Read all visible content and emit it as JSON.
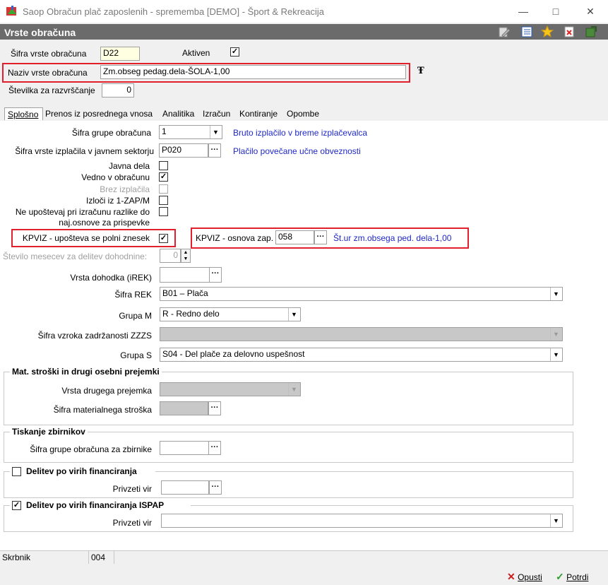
{
  "window": {
    "title": "Saop Obračun plač zaposlenih - sprememba [DEMO] - Šport & Rekreacija",
    "header": "Vrste obračuna"
  },
  "top": {
    "sifra_label": "Šifra vrste obračuna",
    "sifra_value": "D22",
    "aktiven_label": "Aktiven",
    "aktiven_checked": "✓",
    "naziv_label": "Naziv vrste obračuna",
    "naziv_value": "Zm.obseg pedag.dela-ŠOLA-1,00",
    "stevilka_label": "Številka  za razvrščanje",
    "stevilka_value": "0"
  },
  "tabs": [
    {
      "label": "Splošno"
    },
    {
      "label": "Prenos iz posrednega vnosa"
    },
    {
      "label": "Analitika"
    },
    {
      "label": "Izračun"
    },
    {
      "label": "Kontiranje"
    },
    {
      "label": "Opombe"
    }
  ],
  "general": {
    "grupa_label": "Šifra grupe obračuna",
    "grupa_value": "1",
    "grupa_desc": "Bruto izplačilo v breme izplačevalca",
    "izplacila_label": "Šifra vrste izplačila v javnem sektorju",
    "izplacila_value": "P020",
    "izplacila_desc": "Plačilo povečane učne obveznosti",
    "javna_dela_label": "Javna dela",
    "vedno_label": "Vedno v obračunu",
    "vedno_checked": "✓",
    "brez_label": "Brez izplačila",
    "izloci_label": "Izloči iz 1-ZAP/M",
    "neupostevaj_label1": "Ne upoštevaj pri izračunu razlike do",
    "neupostevaj_label2": "naj.osnove za prispevke",
    "kpviz_polni_label": "KPVIZ - upošteva se polni znesek",
    "kpviz_polni_checked": "✓",
    "kpviz_osnova_label": "KPVIZ - osnova zap.",
    "kpviz_osnova_value": "058",
    "kpviz_osnova_desc": "Št.ur zm.obsega ped. dela-1,00",
    "mesecev_label": "Število mesecev za delitev dohodnine:",
    "mesecev_value": "0",
    "irek_label": "Vrsta dohodka (iREK)",
    "irek_value": "",
    "rek_label": "Šifra REK",
    "rek_value": "B01 – Plača",
    "grupam_label": "Grupa M",
    "grupam_value": "R - Redno delo",
    "zzzs_label": "Šifra vzroka zadržanosti ZZZS",
    "zzzs_value": "",
    "grupas_label": "Grupa S",
    "grupas_value": "S04 - Del plače za delovno uspešnost"
  },
  "mat": {
    "title": "Mat. stroški in drugi osebni prejemki",
    "vrsta_label": "Vrsta drugega prejemka",
    "sifra_label": "Šifra materialnega stroška"
  },
  "tisk": {
    "title": "Tiskanje zbirnikov",
    "grupa_label": "Šifra grupe obračuna za zbirnike"
  },
  "delitev": {
    "title": "Delitev po virih financiranja",
    "privzeti_label": "Privzeti vir"
  },
  "delitev_ispap": {
    "title": "Delitev po virih financiranja ISPAP",
    "checked": "✓",
    "privzeti_label": "Privzeti vir"
  },
  "status": {
    "skrbnik_label": "Skrbnik",
    "skrbnik_value": "004"
  },
  "buttons": {
    "opusti": "Opusti",
    "potrdi": "Potrdi"
  },
  "icons": {
    "ellipsis": "···",
    "dropdown": "▼"
  }
}
